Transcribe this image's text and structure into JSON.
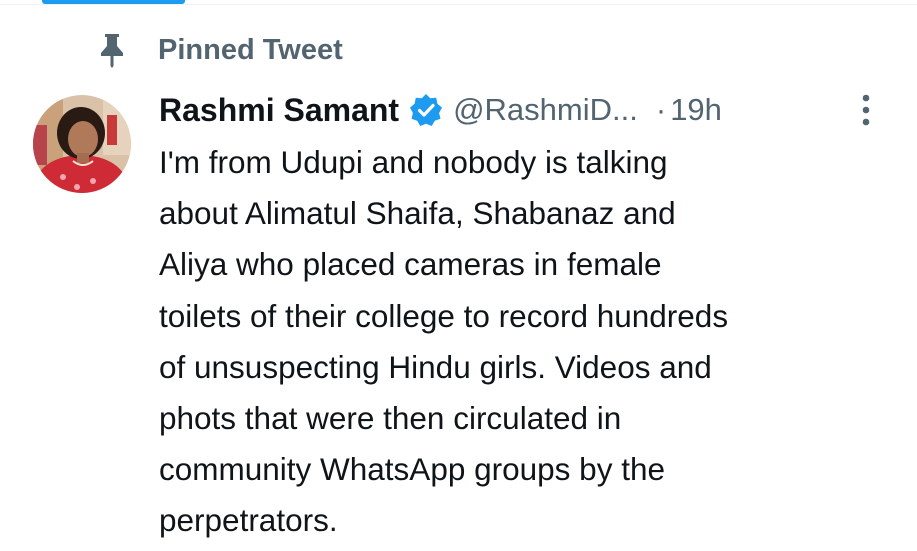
{
  "pinned": {
    "icon": "pin-icon",
    "label": "Pinned Tweet"
  },
  "tweet": {
    "author": {
      "display_name": "Rashmi Samant",
      "verified": true,
      "verified_icon": "verified-badge-icon",
      "handle": "@RashmiD...",
      "avatar": "avatar-photo"
    },
    "separator": "·",
    "timestamp": "19h",
    "more_icon": "more-dots-icon",
    "text_lines": [
      "I'm from Udupi and nobody is talking",
      "about Alimatul Shaifa, Shabanaz and",
      "Aliya who placed cameras in female",
      "toilets of their college to record hundreds",
      "of unsuspecting Hindu girls. Videos and",
      "phots that were then circulated in",
      "community WhatsApp groups by the",
      "perpetrators."
    ]
  },
  "colors": {
    "text_primary": "#0f1419",
    "text_secondary": "#536471",
    "accent": "#1d9bf0",
    "border": "#eff3f4"
  }
}
